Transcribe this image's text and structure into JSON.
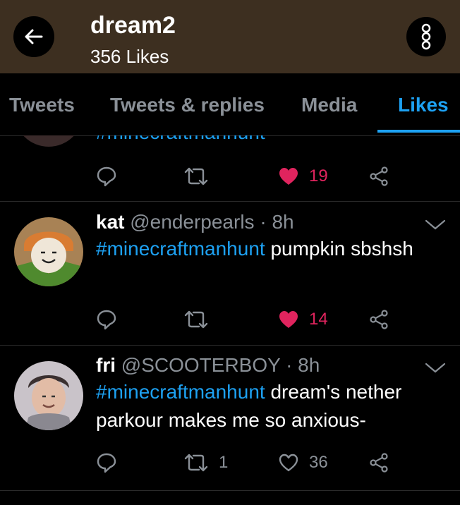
{
  "header": {
    "title": "dream2",
    "subtitle": "356 Likes"
  },
  "tabs": [
    "Tweets",
    "Tweets & replies",
    "Media",
    "Likes"
  ],
  "tweets": [
    {
      "cutoff_text": "#minecraftmanhunt",
      "likes": "19",
      "liked": true
    },
    {
      "name": "kat",
      "handle": "@enderpearls",
      "time": "· 8h",
      "hashtag": "#minecraftmanhunt",
      "text": " pumpkin sbshsh",
      "likes": "14",
      "liked": true
    },
    {
      "name": "fri",
      "handle": "@SCOOTERBOY",
      "time": "· 8h",
      "hashtag": "#minecraftmanhunt",
      "text": " dream's nether parkour makes me so anxious-",
      "retweets": "1",
      "likes": "36",
      "liked": false
    }
  ],
  "colors": {
    "accent": "#1da1f2",
    "like": "#e0245e",
    "header_bg": "#3d2f20",
    "muted": "#8a9097"
  }
}
